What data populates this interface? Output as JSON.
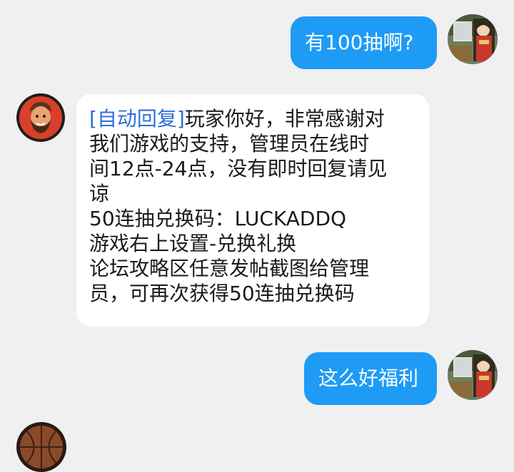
{
  "messages": [
    {
      "side": "right",
      "text": "有100抽啊?",
      "avatar_icon": "anime-girl-avatar-icon"
    },
    {
      "side": "left",
      "avatar_icon": "bearded-man-avatar-icon",
      "tag": "[自动回复]",
      "lines": [
        "玩家你好，非常感谢对",
        "我们游戏的支持，管理员在线时",
        "间12点-24点，没有即时回复请见",
        "谅",
        "50连抽兑换码：LUCKADDQ",
        "游戏右上设置-兑换礼换",
        "论坛攻略区任意发帖截图给管理",
        "员，可再次获得50连抽兑换码"
      ]
    },
    {
      "side": "right",
      "text": "这么好福利",
      "avatar_icon": "anime-girl-avatar-icon"
    },
    {
      "side": "left",
      "avatar_icon": "basketball-avatar-icon"
    }
  ],
  "colors": {
    "background": "#f0f0f0",
    "outgoing_bubble": "#1e9bf5",
    "incoming_bubble": "#ffffff",
    "auto_reply_tag": "#2f6fd8"
  }
}
